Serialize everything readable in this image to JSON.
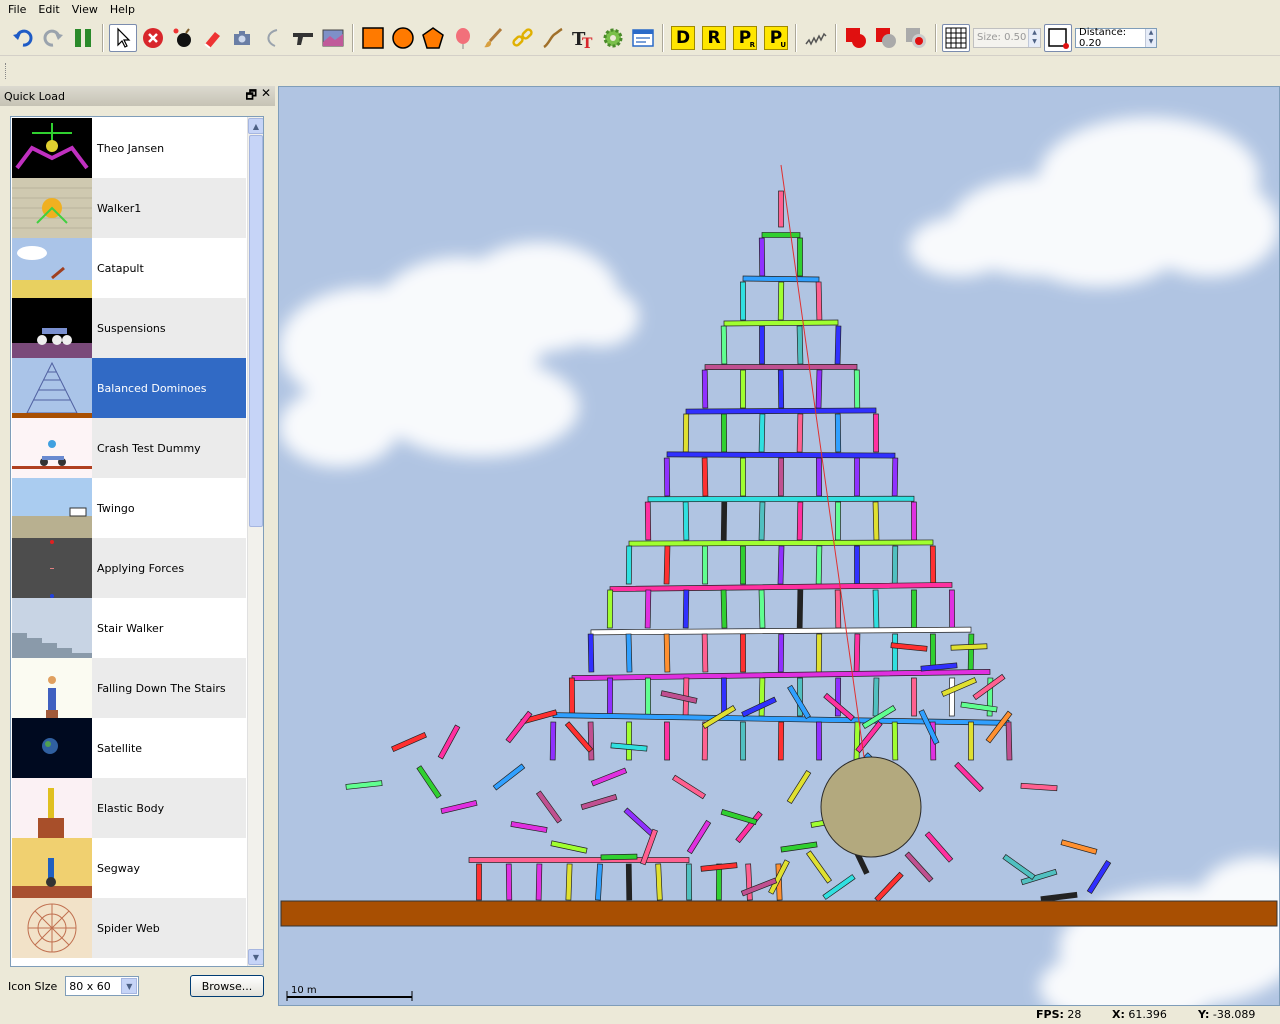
{
  "menu": [
    "File",
    "Edit",
    "View",
    "Help"
  ],
  "toolbar": {
    "letter_tools": [
      {
        "letter": "D",
        "sub": ""
      },
      {
        "letter": "R",
        "sub": ""
      },
      {
        "letter": "P",
        "sub": "R"
      },
      {
        "letter": "P",
        "sub": "U"
      }
    ],
    "size_label": "Size: 0.50",
    "distance_label": "Distance: 0.20"
  },
  "panel": {
    "title": "Quick Load",
    "items": [
      {
        "label": "Theo Jansen"
      },
      {
        "label": "Walker1"
      },
      {
        "label": "Catapult"
      },
      {
        "label": "Suspensions"
      },
      {
        "label": "Balanced Dominoes"
      },
      {
        "label": "Crash Test Dummy"
      },
      {
        "label": "Twingo"
      },
      {
        "label": "Applying Forces"
      },
      {
        "label": "Stair Walker"
      },
      {
        "label": "Falling Down The Stairs"
      },
      {
        "label": "Satellite"
      },
      {
        "label": "Elastic Body"
      },
      {
        "label": "Segway"
      },
      {
        "label": "Spider Web"
      }
    ],
    "selected_index": 4,
    "icon_size_label": "Icon SIze",
    "icon_size_value": "80 x 60",
    "browse_label": "Browse..."
  },
  "canvas": {
    "scale_label": "10 m"
  },
  "status": {
    "fps_label": "FPS:",
    "fps_value": "28",
    "x_label": "X:",
    "x_value": "61.396",
    "y_label": "Y:",
    "y_value": "-38.089"
  }
}
